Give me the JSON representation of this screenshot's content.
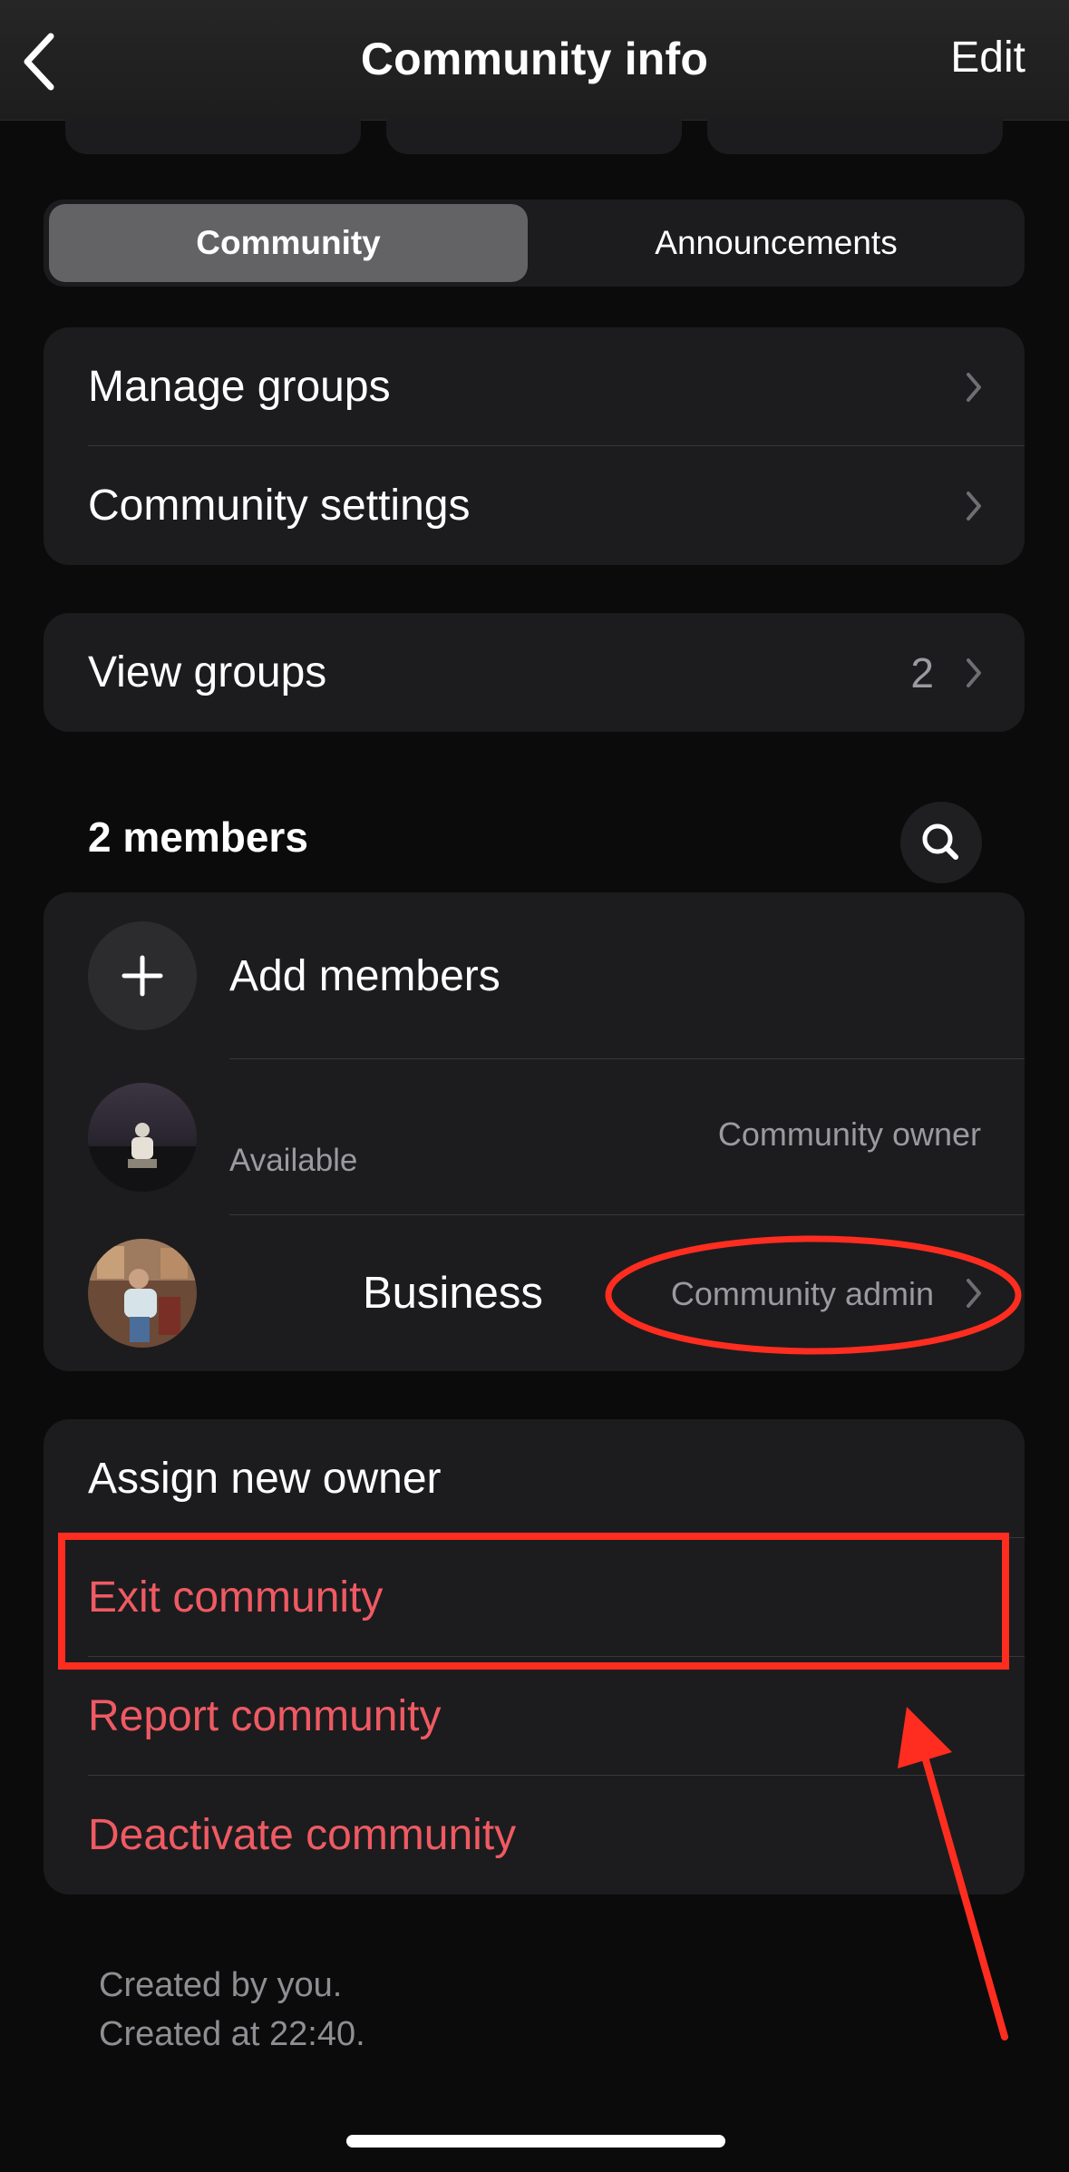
{
  "header": {
    "title": "Community info",
    "edit_label": "Edit",
    "back_icon": "chevron-left-icon"
  },
  "tabs": [
    {
      "label": "Community",
      "selected": true
    },
    {
      "label": "Announcements",
      "selected": false
    }
  ],
  "admin_menu": [
    {
      "label": "Manage groups"
    },
    {
      "label": "Community settings"
    }
  ],
  "view_groups": {
    "label": "View groups",
    "count": "2"
  },
  "members": {
    "title": "2 members",
    "add_label": "Add members",
    "list": [
      {
        "name": "",
        "status": "Available",
        "role": "Community owner"
      },
      {
        "name": "Business",
        "status": "",
        "role": "Community admin"
      }
    ]
  },
  "actions": [
    {
      "label": "Assign new owner",
      "destructive": false
    },
    {
      "label": "Exit community",
      "destructive": true
    },
    {
      "label": "Report community",
      "destructive": true
    },
    {
      "label": "Deactivate community",
      "destructive": true
    }
  ],
  "footer": {
    "created_by": "Created by you.",
    "created_at": "Created at 22:40."
  },
  "colors": {
    "background": "#0b0b0b",
    "card": "#1c1c1e",
    "destructive": "#ef5a63",
    "annotation": "#ff2d20"
  }
}
